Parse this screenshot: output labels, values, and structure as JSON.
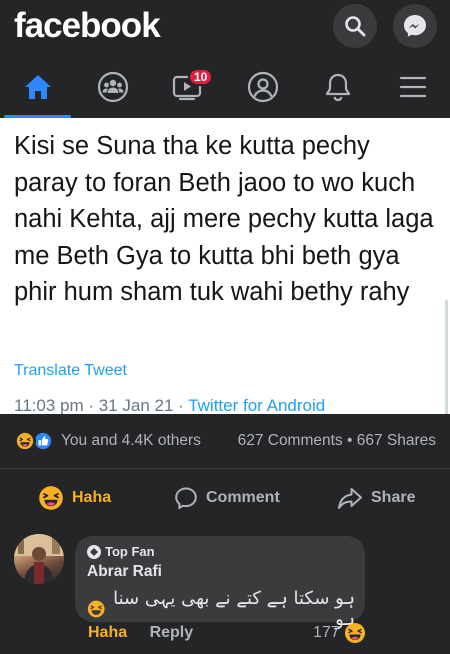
{
  "header": {
    "logo": "facebook"
  },
  "nav": {
    "notification_badge": "10"
  },
  "tweet": {
    "text": "Kisi se Suna tha ke kutta pechy paray to foran Beth jaoo to wo kuch nahi Kehta, ajj mere pechy kutta laga me Beth Gya to kutta bhi beth gya phir hum sham tuk wahi bethy rahy",
    "translate": "Translate Tweet",
    "time_date": "11:03 pm · 31 Jan 21 · ",
    "source": "Twitter for Android"
  },
  "reactions": {
    "summary": "You and 4.4K others",
    "stats": "627 Comments • 667 Shares"
  },
  "actions": {
    "haha": "Haha",
    "comment": "Comment",
    "share": "Share"
  },
  "comment": {
    "badge": "Top Fan",
    "author": "Abrar Rafi",
    "text": "ہو سکتا ہے کتے نے بھی یہی سنا ہو",
    "haha": "Haha",
    "reply": "Reply",
    "reaction_count": "177"
  },
  "colors": {
    "accent": "#2d88ff",
    "haha": "#f7b125",
    "badge": "#e41e3f",
    "twitter_blue": "#1da1f2"
  }
}
